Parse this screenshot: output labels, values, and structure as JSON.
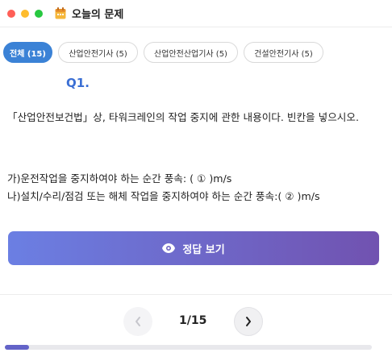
{
  "window": {
    "title": "오늘의 문제"
  },
  "tabs": [
    {
      "label": "전체 (15)",
      "active": true
    },
    {
      "label": "산업안전기사 (5)",
      "active": false
    },
    {
      "label": "산업안전산업기사 (5)",
      "active": false
    },
    {
      "label": "건설안전기사 (5)",
      "active": false
    }
  ],
  "question": {
    "number": "Q1.",
    "text": "「산업안전보건법」상, 타워크레인의 작업 중지에 관한 내용이다. 빈칸을 넣으시오.",
    "options": [
      "가)운전작업을 중지하여야 하는 순간 풍속: ( ① )m/s",
      "나)설치/수리/점검 또는 해체 작업을 중지하여야 하는 순간 풍속:( ② )m/s"
    ]
  },
  "answer_button": {
    "label": "정답 보기",
    "icon": "eye-icon"
  },
  "pagination": {
    "indicator": "1/15",
    "current": 1,
    "total": 15
  },
  "progress": {
    "fraction": 0.0667
  },
  "colors": {
    "accent": "#3b82d6",
    "question_number": "#3b6fd4",
    "button_gradient_start": "#6b7fe3",
    "button_gradient_end": "#7152b0",
    "progress_fill": "#6363c8"
  }
}
